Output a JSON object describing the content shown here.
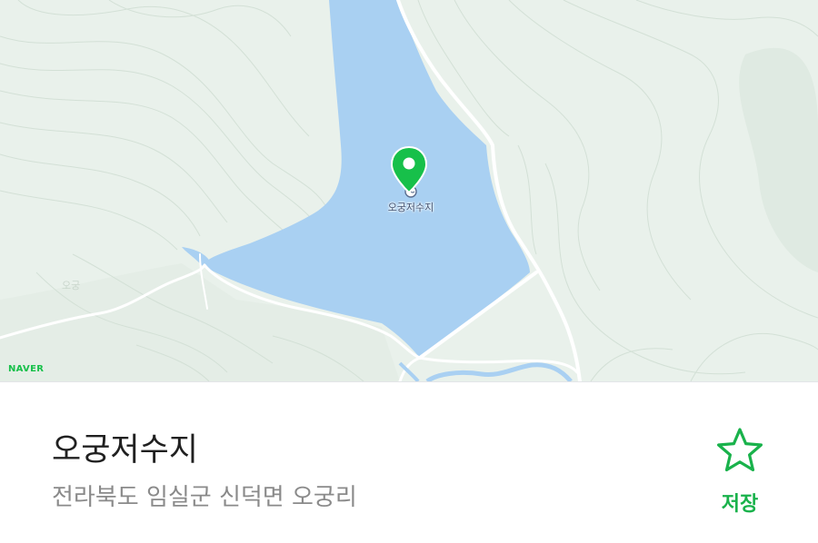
{
  "map": {
    "provider_logo": "NAVER",
    "marker_label": "오궁저수지",
    "icons": [
      "location-pin-icon",
      "reservoir-icon"
    ],
    "colors": {
      "land": "#e9f1eb",
      "water": "#a9d0f2",
      "road": "#ffffff",
      "pin": "#17c04a"
    }
  },
  "place": {
    "name": "오궁저수지",
    "address": "전라북도 임실군 신덕면 오궁리"
  },
  "actions": {
    "save_label": "저장",
    "save_icon": "star-outline-icon",
    "accent_color": "#19b24b"
  }
}
